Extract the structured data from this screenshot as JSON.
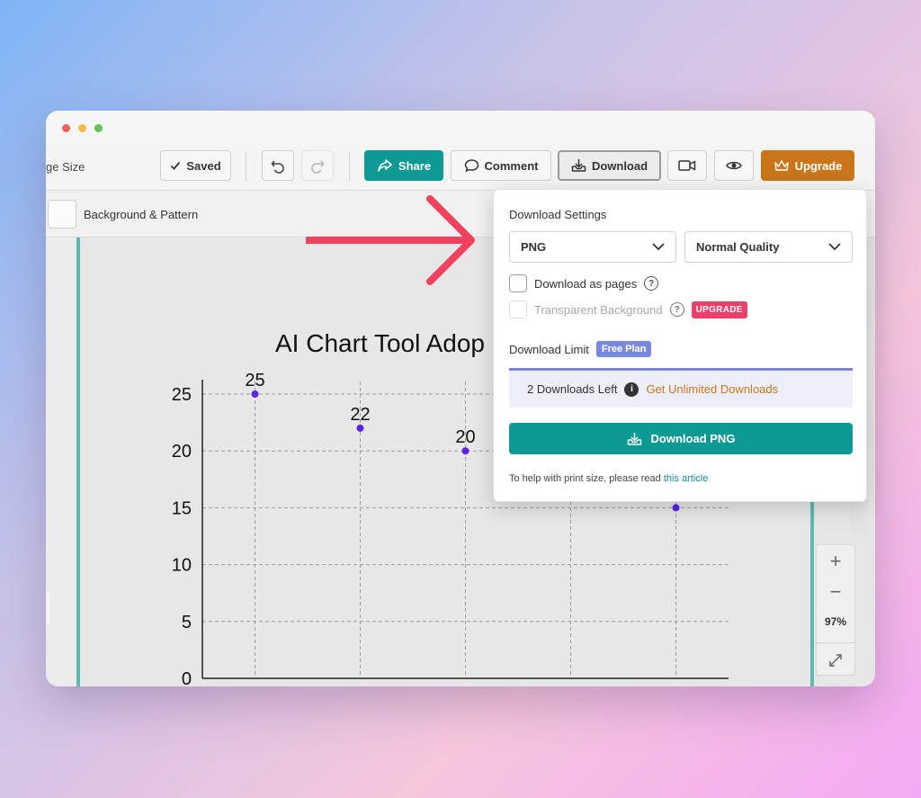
{
  "colors": {
    "teal": "#0e9a94",
    "upgrade": "#c9761a",
    "upgrade_badge": "#ec3f6b",
    "plan_badge": "#7a89e0",
    "chart_point": "#5a24e8",
    "arrow": "#f1415f"
  },
  "toolbar": {
    "page_size_label": "ge Size",
    "saved_label": "Saved",
    "share_label": "Share",
    "comment_label": "Comment",
    "download_label": "Download",
    "upgrade_label": "Upgrade"
  },
  "subbar": {
    "background_label": "Background & Pattern"
  },
  "zoom": {
    "plus": "+",
    "minus": "−",
    "level": "97%"
  },
  "popup": {
    "heading": "Download Settings",
    "format_value": "PNG",
    "quality_value": "Normal Quality",
    "download_as_pages": "Download as pages",
    "transparent_background": "Transparent Background",
    "upgrade_badge": "UPGRADE",
    "download_limit": "Download Limit",
    "plan_badge": "Free Plan",
    "downloads_left": "2 Downloads Left",
    "get_unlimited": "Get Unlimited Downloads",
    "download_button": "Download PNG",
    "help_prefix": "To help with print size, please read ",
    "help_link": "this article"
  },
  "chart_data": {
    "type": "scatter",
    "title": "AI Chart Tool Adop",
    "ylim": [
      0,
      25
    ],
    "yticks": [
      0,
      5,
      10,
      15,
      20,
      25
    ],
    "grid": true,
    "points": [
      {
        "x": 1,
        "y": 25,
        "label": "25"
      },
      {
        "x": 2,
        "y": 22,
        "label": "22"
      },
      {
        "x": 3,
        "y": 20,
        "label": "20"
      },
      {
        "x": 5,
        "y": 15,
        "label": ""
      }
    ],
    "xlim": [
      0.5,
      5.5
    ]
  }
}
